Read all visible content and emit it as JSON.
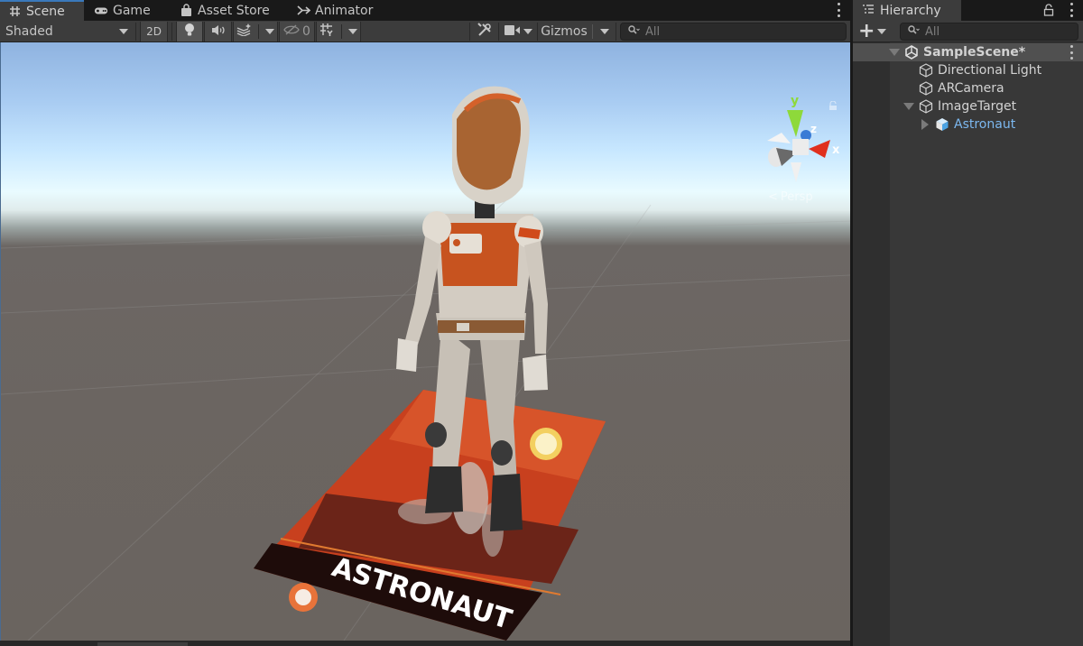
{
  "scene_window": {
    "tabs": [
      {
        "label": "Scene",
        "icon": "grid-hash-icon",
        "active": true
      },
      {
        "label": "Game",
        "icon": "gamepad-icon",
        "active": false
      },
      {
        "label": "Asset Store",
        "icon": "shopping-bag-icon",
        "active": false
      },
      {
        "label": "Animator",
        "icon": "animator-icon",
        "active": false
      }
    ],
    "toolbar": {
      "draw_mode": "Shaded",
      "toggle_2d": "2D",
      "lighting_icon": "lightbulb-icon",
      "audio_icon": "speaker-icon",
      "effects_icon": "effects-layers-icon",
      "hidden_count": "0",
      "hidden_icon": "eye-slash-icon",
      "grid_icon": "grid-snap-icon",
      "tools_icon": "tools-icon",
      "camera_icon": "camera-icon",
      "gizmos_label": "Gizmos",
      "search_placeholder": "All"
    },
    "viewport": {
      "projection_label": "Persp",
      "gizmo_axes": {
        "x": "x",
        "y": "y",
        "z": "z"
      },
      "image_target_title": "ASTRONAUT",
      "colors": {
        "axis_x": "#e0301e",
        "axis_y": "#8ed93a",
        "axis_z": "#3a7bd5",
        "ground": "#6b6561",
        "sky_top": "#8fb3e0",
        "horizon": "#e9fbff",
        "poster_orange": "#d2421e"
      }
    }
  },
  "hierarchy": {
    "title": "Hierarchy",
    "search_placeholder": "All",
    "add_label": "+",
    "items": [
      {
        "label": "SampleScene*",
        "depth": 0,
        "expanded": true,
        "type": "scene",
        "icon": "unity-scene-icon"
      },
      {
        "label": "Directional Light",
        "depth": 1,
        "type": "gameobject",
        "icon": "cube-outline-icon"
      },
      {
        "label": "ARCamera",
        "depth": 1,
        "type": "gameobject",
        "icon": "cube-outline-icon"
      },
      {
        "label": "ImageTarget",
        "depth": 1,
        "expanded": true,
        "type": "gameobject",
        "icon": "cube-outline-icon"
      },
      {
        "label": "Astronaut",
        "depth": 2,
        "expanded": false,
        "type": "prefab",
        "icon": "prefab-cube-icon"
      }
    ],
    "colors": {
      "prefab_text": "#7cb8f0",
      "selected_row": "#505050"
    }
  }
}
